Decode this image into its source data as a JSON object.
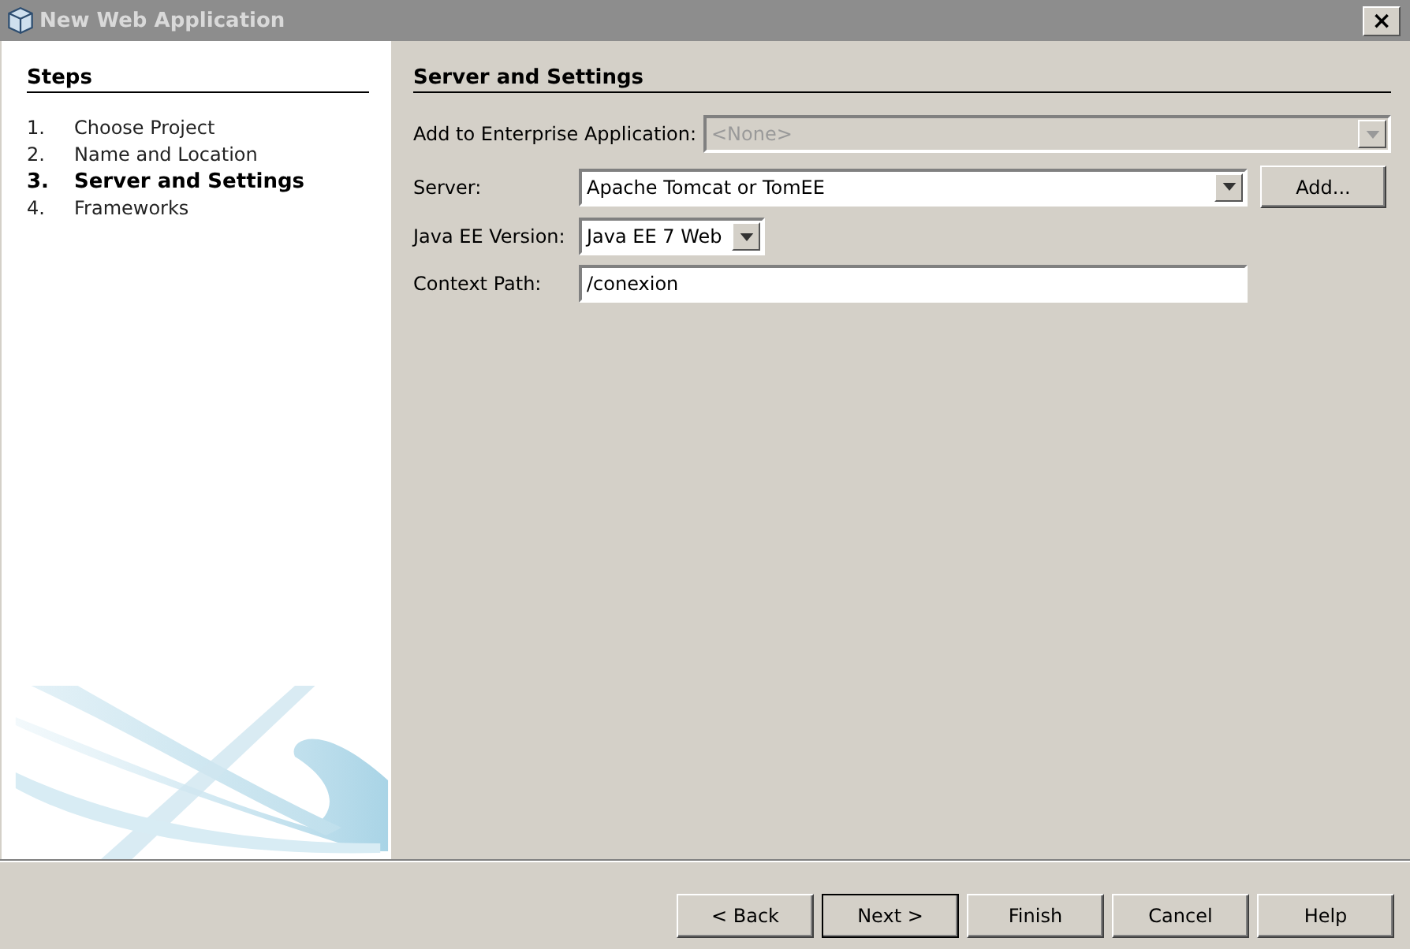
{
  "window": {
    "title": "New Web Application",
    "close": "×"
  },
  "steps": {
    "title": "Steps",
    "items": [
      {
        "number": "1.",
        "label": "Choose Project",
        "selected": false
      },
      {
        "number": "2.",
        "label": "Name and Location",
        "selected": false
      },
      {
        "number": "3.",
        "label": "Server and Settings",
        "selected": true
      },
      {
        "number": "4.",
        "label": "Frameworks",
        "selected": false
      }
    ]
  },
  "panel": {
    "title": "Server and Settings",
    "fields": [
      {
        "kind": "dropdown",
        "label": "Add to Enterprise Application:",
        "value": "<None>",
        "disabled": true
      },
      {
        "kind": "dropdown",
        "label": "Server:",
        "value": "Apache Tomcat or TomEE",
        "disabled": false,
        "button": "Add..."
      },
      {
        "kind": "dropdown",
        "label": "Java EE Version:",
        "value": "Java EE 7 Web",
        "disabled": false
      },
      {
        "kind": "text",
        "label": "Context Path:",
        "value": "/conexion",
        "disabled": false
      }
    ]
  },
  "buttons": [
    {
      "label": "< Back",
      "default": false
    },
    {
      "label": "Next >",
      "default": true
    },
    {
      "label": "Finish",
      "default": false
    },
    {
      "label": "Cancel",
      "default": false
    },
    {
      "label": "Help",
      "default": false
    }
  ]
}
